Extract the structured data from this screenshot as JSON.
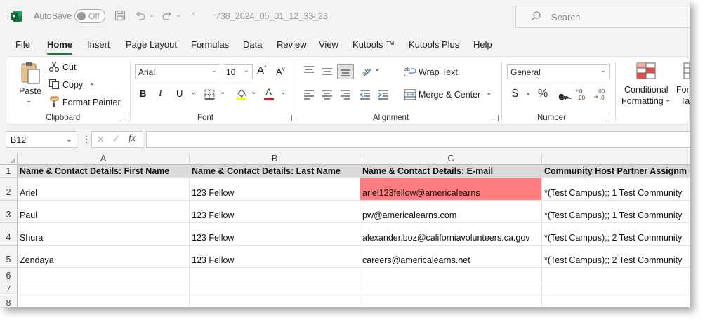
{
  "titlebar": {
    "autosave_label": "AutoSave",
    "autosave_state": "Off",
    "filename": "738_2024_05_01_12_33_23",
    "search_placeholder": "Search"
  },
  "menu": {
    "tabs": [
      "File",
      "Home",
      "Insert",
      "Page Layout",
      "Formulas",
      "Data",
      "Review",
      "View",
      "Kutools ™",
      "Kutools Plus",
      "Help"
    ],
    "active": "Home"
  },
  "ribbon": {
    "clipboard": {
      "paste": "Paste",
      "cut": "Cut",
      "copy": "Copy",
      "format_painter": "Format Painter",
      "label": "Clipboard"
    },
    "font": {
      "font_name": "Arial",
      "font_size": "10",
      "bold": "B",
      "italic": "I",
      "underline": "U",
      "font_color_letter": "A",
      "label": "Font"
    },
    "alignment": {
      "wrap_text": "Wrap Text",
      "merge_center": "Merge & Center",
      "label": "Alignment"
    },
    "number": {
      "format": "General",
      "currency": "$",
      "percent": "%",
      "comma": "๛",
      "label": "Number"
    },
    "styles": {
      "conditional_1": "Conditional",
      "conditional_2": "Formatting",
      "format_as_table_1": "Form",
      "format_as_table_2": "Ta"
    }
  },
  "formula_bar": {
    "name_box": "B12",
    "fx": "fx",
    "value": ""
  },
  "sheet": {
    "columns": [
      "A",
      "B",
      "C"
    ],
    "row_numbers": [
      "1",
      "2",
      "3",
      "4",
      "5",
      "6",
      "7",
      "8"
    ],
    "headers": [
      "Name & Contact Details: First Name",
      "Name & Contact Details: Last Name",
      "Name & Contact Details: E-mail",
      "Community Host Partner Assignm"
    ],
    "rows": [
      [
        "Ariel",
        "123 Fellow",
        "ariel123fellow@americalearns",
        "*(Test Campus);; 1 Test Community"
      ],
      [
        "Paul",
        "123 Fellow",
        "pw@americalearns.com",
        "*(Test Campus);; 1 Test Community"
      ],
      [
        "Shura",
        "123 Fellow",
        "alexander.boz@californiavolunteers.ca.gov",
        "*(Test Campus);; 2 Test Community"
      ],
      [
        "Zendaya",
        "123 Fellow",
        "careers@americalearns.net",
        "*(Test Campus);; 2 Test Community"
      ]
    ],
    "highlight_color": "#ff7c80",
    "header_fill": "#d9d9d9",
    "accent": "#217346"
  }
}
